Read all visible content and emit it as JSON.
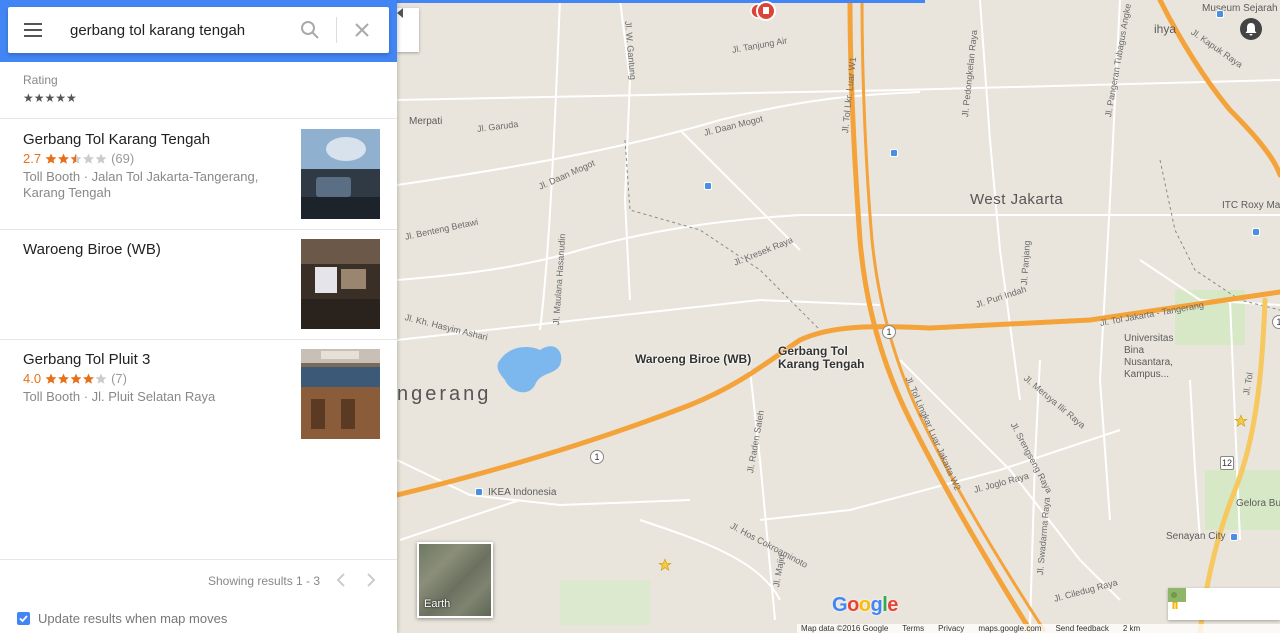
{
  "search": {
    "query": "gerbang tol karang tengah"
  },
  "filter": {
    "rating_label": "Rating",
    "rating_stars": "★★★★★"
  },
  "results": [
    {
      "title": "Gerbang Tol Karang Tengah",
      "rating": "2.7",
      "stars_filled": 2.5,
      "count": "(69)",
      "desc": "Toll Booth · Jalan Tol Jakarta-Tangerang, Karang Tengah"
    },
    {
      "title": "Waroeng Biroe (WB)"
    },
    {
      "title": "Gerbang Tol Pluit 3",
      "rating": "4.0",
      "stars_filled": 4,
      "count": "(7)",
      "desc": "Toll Booth · Jl. Pluit Selatan Raya"
    }
  ],
  "pager": {
    "text": "Showing results 1 - 3"
  },
  "update_toggle": {
    "label": "Update results when map moves",
    "checked": true
  },
  "map": {
    "districts": {
      "west_jakarta": "West Jakarta",
      "tangerang": "ngerang"
    },
    "places": {
      "museum": "Museum Sejarah",
      "ihya": "ihya",
      "merpati": "Merpati",
      "itc": "ITC Roxy Ma",
      "universitas": "Universitas\nBina\nNusantara,\nKampus...",
      "ikea": "IKEA Indonesia",
      "gelora": "Gelora Bu",
      "senayan": "Senayan City"
    },
    "marker_labels": {
      "left": "Waroeng Biroe (WB)",
      "right": "Gerbang Tol\nKarang Tengah"
    },
    "roads": {
      "gantung": "Jl. W. Gantung",
      "lingkar": "Jl. Tol Lkr. Luar W1",
      "kapuk": "Jl. Kapuk Raya",
      "tanjung": "Jl. Tanjung Air",
      "pedongkelan": "Jl. Pedongkelan Raya",
      "pangeran": "Jl. Pangeran Tubagus Angke",
      "garuda": "Jl. Garuda",
      "daan1": "Jl. Daan Mogot",
      "daan2": "Jl. Daan Mogot",
      "benteng": "Jl. Benteng Betawi",
      "hasanudin": "Jl. Maulana Hasanudin",
      "kresek": "Jl. Kresek Raya",
      "panjang": "Jl. Panjang",
      "hasyim": "Jl. Kh. Hasyim Ashari",
      "puri": "Jl. Puri Indah",
      "tol_jkt": "Jl. Tol Jakarta - Tangerang",
      "tol_lingkar": "Jl. Tol Lingkar Luar Jakarta W2",
      "meruya": "Jl. Meruya Ilir Raya",
      "srengseng": "Jl. Srengseng Raya",
      "raden": "Jl. Raden Saleh",
      "joglo": "Jl. Joglo Raya",
      "hos": "Jl. Hos Cokroaminoto",
      "swadarma": "Jl. Swadarma Raya",
      "ciledug": "Jl. Ciledug Raya",
      "majid": "Jl. Majid",
      "tol": "Jl. Tol"
    },
    "shields": [
      "1",
      "1",
      "1",
      "12"
    ],
    "earth_label": "Earth",
    "google_logo": [
      "G",
      "o",
      "o",
      "g",
      "l",
      "e"
    ],
    "footer": [
      "Map data ©2016 Google",
      "Terms",
      "Privacy",
      "maps.google.com",
      "Send feedback",
      "2 km"
    ]
  },
  "colors": {
    "accent": "#4285f4",
    "highway": "#f3a33a",
    "marker": "#db4437",
    "star": "#e7711b",
    "map_bg": "#e9e5dc",
    "water": "#7cb8ee"
  }
}
